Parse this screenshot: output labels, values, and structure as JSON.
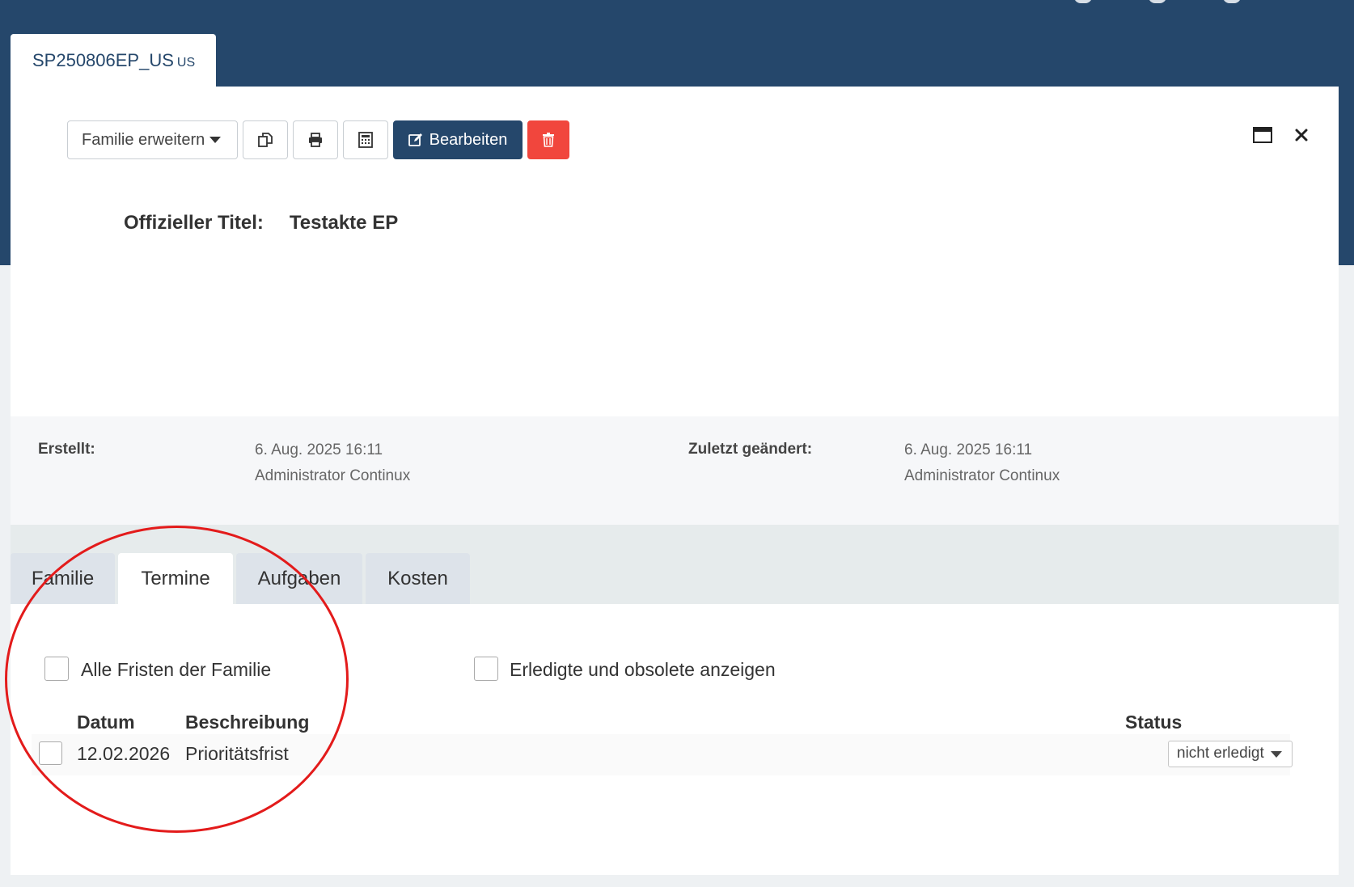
{
  "document_tab": {
    "code": "SP250806EP_US",
    "country": "US"
  },
  "toolbar": {
    "family_button_label": "Familie erweitern",
    "edit_button_label": "Bearbeiten"
  },
  "record": {
    "title_label": "Offizieller Titel:",
    "title_value": "Testakte EP"
  },
  "meta": {
    "created_label": "Erstellt:",
    "created_date": "6. Aug. 2025 16:11",
    "created_by": "Administrator Continux",
    "modified_label": "Zuletzt geändert:",
    "modified_date": "6. Aug. 2025 16:11",
    "modified_by": "Administrator Continux"
  },
  "tabs": [
    {
      "label": "Familie",
      "active": false
    },
    {
      "label": "Termine",
      "active": true
    },
    {
      "label": "Aufgaben",
      "active": false
    },
    {
      "label": "Kosten",
      "active": false
    }
  ],
  "filters": {
    "family_deadlines_label": "Alle Fristen der Familie",
    "show_done_label": "Erledigte und obsolete anzeigen"
  },
  "table": {
    "headers": {
      "date": "Datum",
      "description": "Beschreibung",
      "status": "Status"
    },
    "rows": [
      {
        "date": "12.02.2026",
        "description": "Prioritätsfrist",
        "status": "nicht erledigt"
      }
    ]
  },
  "colors": {
    "header_bg": "#25476b",
    "edit_button": "#25476b",
    "delete_button": "#f1463d",
    "highlight_circle": "#e31b1b"
  }
}
